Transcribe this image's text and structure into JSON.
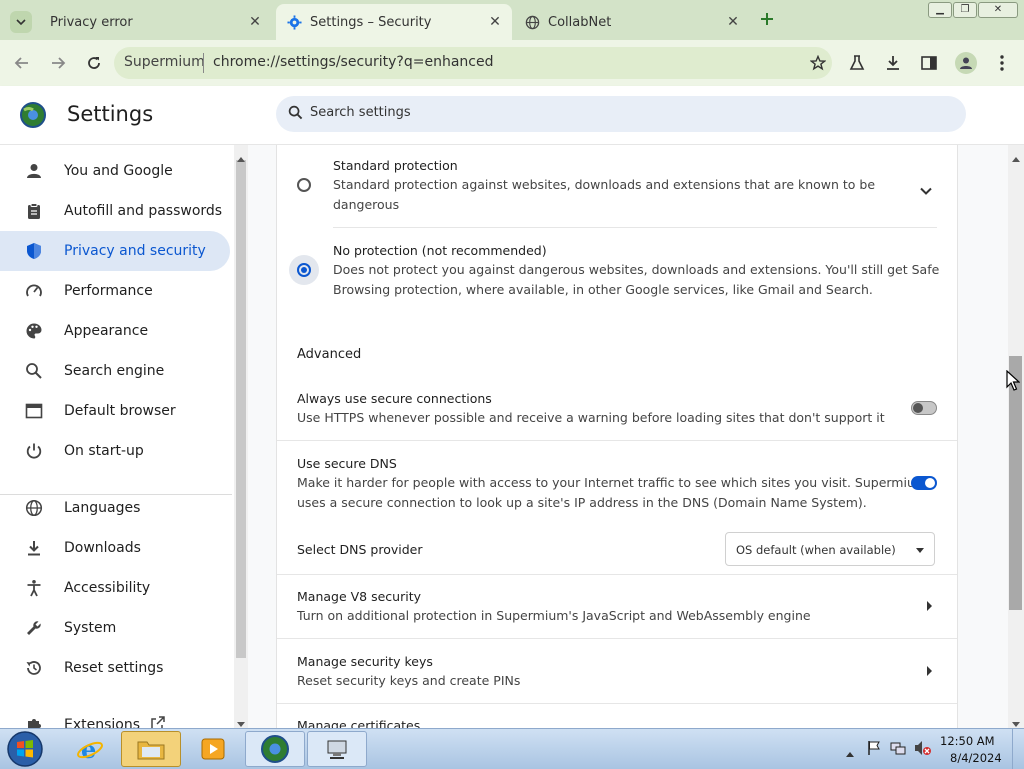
{
  "window": {
    "tabs": [
      {
        "title": "Privacy error",
        "icon": "chevron-down-icon"
      },
      {
        "title": "Settings – Security",
        "icon": "gear-icon"
      },
      {
        "title": "CollabNet",
        "icon": "globe-icon"
      }
    ],
    "new_tab_icon": "plus-icon"
  },
  "toolbar": {
    "origin": "Supermium",
    "url": "chrome://settings/security?q=enhanced"
  },
  "header": {
    "title": "Settings",
    "search_placeholder": "Search settings"
  },
  "sidebar": {
    "items": [
      {
        "label": "You and Google",
        "icon": "person-icon"
      },
      {
        "label": "Autofill and passwords",
        "icon": "clipboard-icon"
      },
      {
        "label": "Privacy and security",
        "icon": "shield-icon",
        "active": true
      },
      {
        "label": "Performance",
        "icon": "speedometer-icon"
      },
      {
        "label": "Appearance",
        "icon": "palette-icon"
      },
      {
        "label": "Search engine",
        "icon": "search-icon"
      },
      {
        "label": "Default browser",
        "icon": "browser-icon"
      },
      {
        "label": "On start-up",
        "icon": "power-icon"
      },
      {
        "label": "Languages",
        "icon": "globe-icon"
      },
      {
        "label": "Downloads",
        "icon": "download-icon"
      },
      {
        "label": "Accessibility",
        "icon": "accessibility-icon"
      },
      {
        "label": "System",
        "icon": "wrench-icon"
      },
      {
        "label": "Reset settings",
        "icon": "history-icon"
      },
      {
        "label": "Extensions",
        "icon": "puzzle-icon"
      }
    ]
  },
  "main": {
    "standard": {
      "title": "Standard protection",
      "desc_line1": "Standard protection against websites, downloads and extensions that are known to be",
      "desc_line2": "dangerous"
    },
    "no_protection": {
      "title": "No protection (not recommended)",
      "desc_line1": "Does not protect you against dangerous websites, downloads and extensions. You'll still get Safe",
      "desc_line2": "Browsing protection, where available, in other Google services, like Gmail and Search."
    },
    "advanced_heading": "Advanced",
    "https": {
      "title": "Always use secure connections",
      "desc": "Use HTTPS whenever possible and receive a warning before loading sites that don't support it",
      "enabled": false
    },
    "secure_dns": {
      "title": "Use secure DNS",
      "desc_line1": "Make it harder for people with access to your Internet traffic to see which sites you visit. Supermium",
      "desc_line2": "uses a secure connection to look up a site's IP address in the DNS (Domain Name System).",
      "enabled": true
    },
    "dns_provider": {
      "label": "Select DNS provider",
      "value": "OS default (when available)"
    },
    "v8": {
      "title": "Manage V8 security",
      "desc": "Turn on additional protection in Supermium's JavaScript and WebAssembly engine"
    },
    "security_keys": {
      "title": "Manage security keys",
      "desc": "Reset security keys and create PINs"
    },
    "certificates": {
      "title": "Manage certificates"
    }
  },
  "taskbar": {
    "time": "12:50 AM",
    "date": "8/4/2024"
  },
  "colors": {
    "accent": "#0b57d0",
    "tabstrip": "#d3e3c8",
    "toolbar": "#eef5e6"
  }
}
